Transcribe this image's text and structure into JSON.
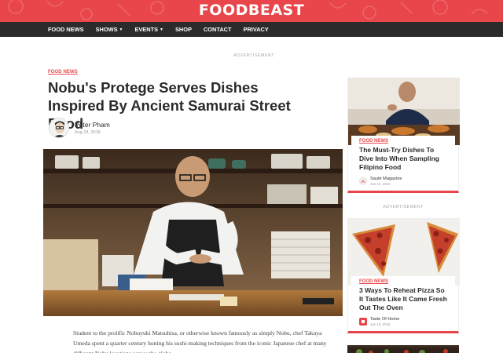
{
  "site": {
    "logo": "FOODBEAST",
    "brand_color": "#e8464b",
    "nav": [
      {
        "label": "FOOD NEWS",
        "dropdown": false
      },
      {
        "label": "SHOWS",
        "dropdown": true
      },
      {
        "label": "EVENTS",
        "dropdown": true
      },
      {
        "label": "SHOP",
        "dropdown": false
      },
      {
        "label": "CONTACT",
        "dropdown": false
      },
      {
        "label": "PRIVACY",
        "dropdown": false
      }
    ],
    "ad_label": "ADVERTISEMENT"
  },
  "article": {
    "category": "FOOD NEWS",
    "title": "Nobu's Protege Serves Dishes Inspired By Ancient Samurai Street Food",
    "author": "Peter Pham",
    "date": "Aug 24, 2018",
    "body": "Student to the prolific Nobuyuki Matsuhisa, or otherwise known famously as simply Nobu, chef Takuya Umeda spent a quarter century honing his sushi-making techniques from the iconic Japanese chef at many different Nobu locations across the globe."
  },
  "sidebar": {
    "cards": [
      {
        "category": "FOOD NEWS",
        "title": "The Must-Try Dishes To Dive Into When Sampling Filipino Food",
        "source": "Sauté Magazine",
        "date": "Jun 16, 2019"
      },
      {
        "category": "FOOD NEWS",
        "title": "3 Ways To Reheat Pizza So It Tastes Like It Came Fresh Out The Oven",
        "source": "Taste Of Home",
        "date": "Jun 15, 2019"
      }
    ],
    "ad_label": "ADVERTISEMENT"
  }
}
